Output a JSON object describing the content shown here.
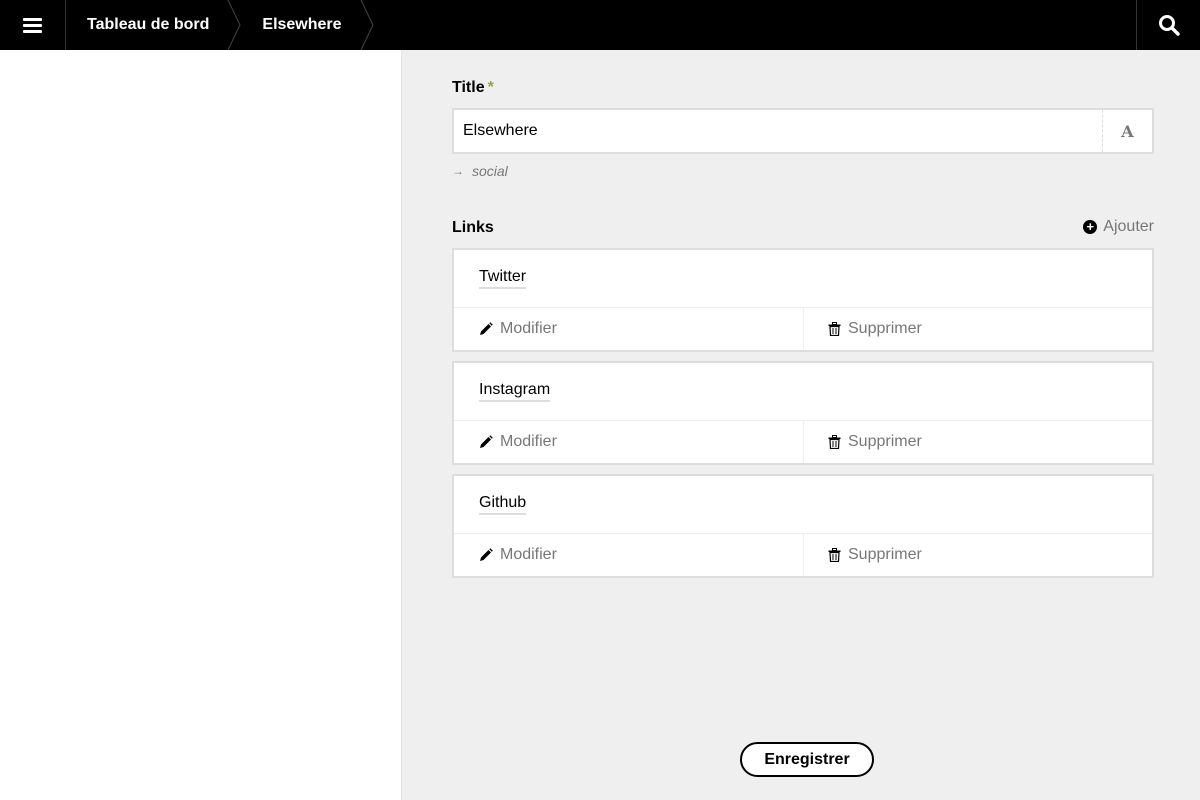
{
  "topbar": {
    "breadcrumbs": [
      "Tableau de bord",
      "Elsewhere"
    ]
  },
  "form": {
    "title_label": "Title",
    "title_required_mark": "*",
    "title_value": "Elsewhere",
    "title_addon": "A",
    "slug": "social",
    "links_label": "Links",
    "add_label": "Ajouter",
    "links": [
      {
        "title": "Twitter",
        "modify_label": "Modifier",
        "delete_label": "Supprimer"
      },
      {
        "title": "Instagram",
        "modify_label": "Modifier",
        "delete_label": "Supprimer"
      },
      {
        "title": "Github",
        "modify_label": "Modifier",
        "delete_label": "Supprimer"
      }
    ],
    "save_label": "Enregistrer"
  },
  "colors": {
    "topbar": "#000000",
    "panel": "#efefef",
    "required": "#8dae28",
    "muted_text": "#777777"
  },
  "icons": {
    "menu": "hamburger-icon",
    "search": "search-icon",
    "add": "plus-circle-icon",
    "modify": "pencil-icon",
    "delete": "trash-icon",
    "slug": "arrow-right-icon",
    "title_addon": "letter-a-icon"
  }
}
